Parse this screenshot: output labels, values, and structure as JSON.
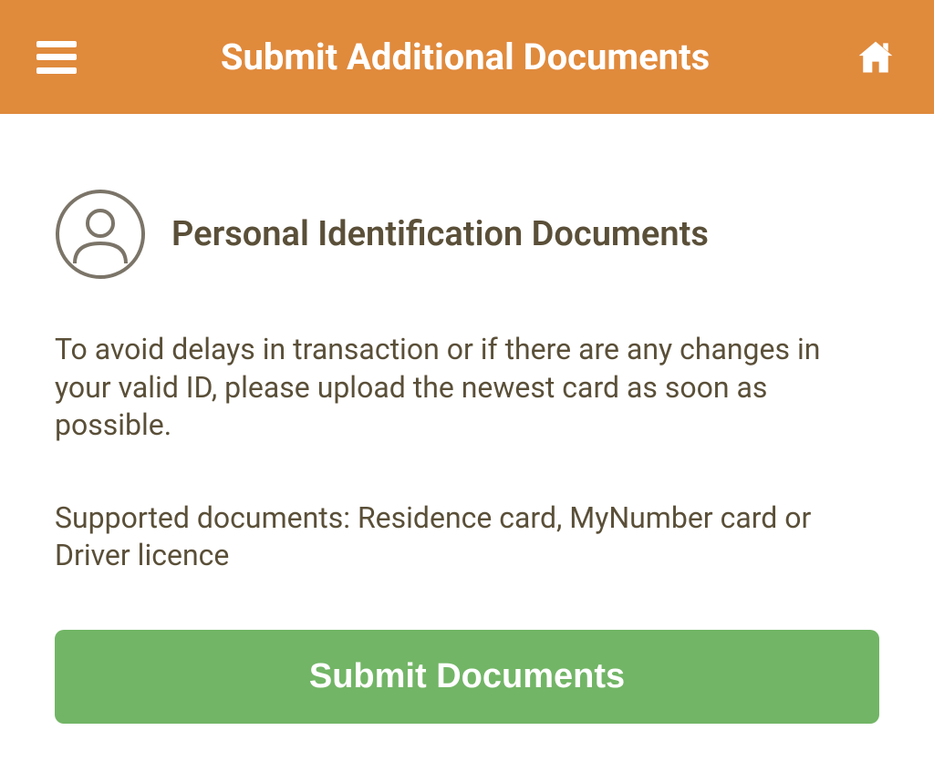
{
  "header": {
    "title": "Submit Additional Documents"
  },
  "section": {
    "title": "Personal Identification Documents",
    "description": "To avoid delays in transaction or if there are any changes in your valid ID, please upload the newest card as soon as possible.",
    "supported": "Supported documents: Residence card, MyNumber card or Driver licence",
    "button_label": "Submit Documents"
  },
  "colors": {
    "header_bg": "#e08a3c",
    "button_bg": "#72b566",
    "text_primary": "#5a4f38"
  }
}
